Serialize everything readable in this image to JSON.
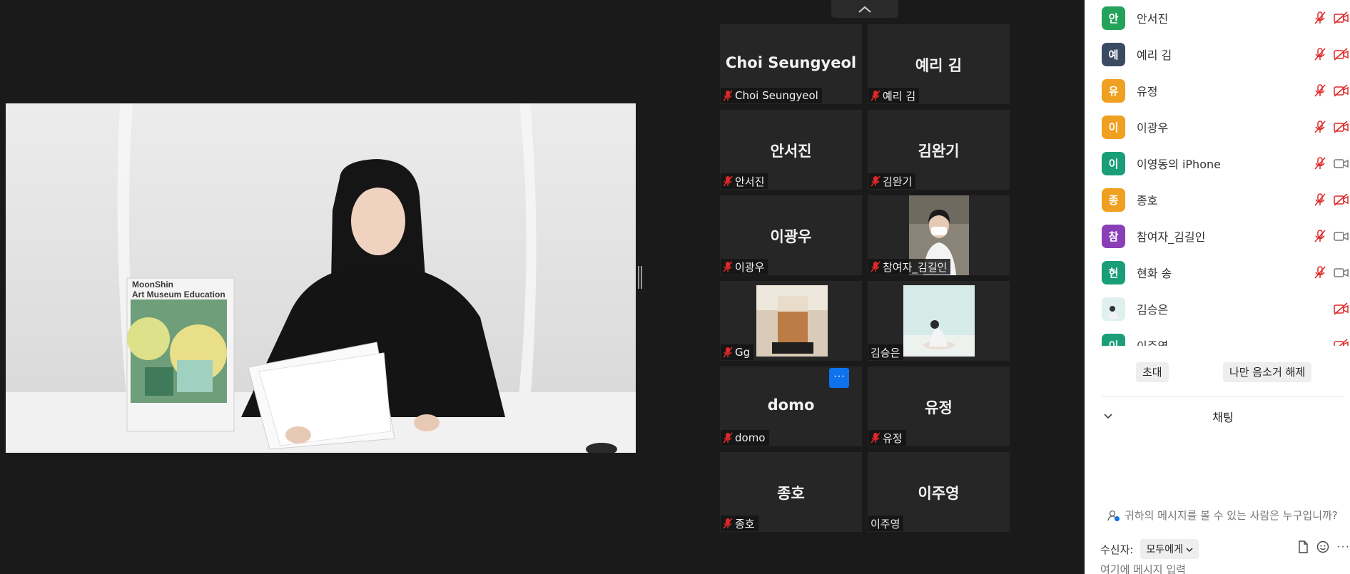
{
  "poster": {
    "title_line1": "MoonShin",
    "title_line2": "Art Museum Education"
  },
  "tiles": [
    {
      "display": "Choi Seungyeol",
      "label": "Choi Seungyeol",
      "muted": true
    },
    {
      "display": "예리 김",
      "label": "예리 김",
      "muted": true
    },
    {
      "display": "안서진",
      "label": "안서진",
      "muted": true
    },
    {
      "display": "김완기",
      "label": "김완기",
      "muted": true
    },
    {
      "display": "이광우",
      "label": "이광우",
      "muted": true
    },
    {
      "display": "",
      "label": "참여자_김길인",
      "muted": true
    },
    {
      "display": "",
      "label": "Gg",
      "muted": true
    },
    {
      "display": "",
      "label": "김승은",
      "muted": false
    },
    {
      "display": "domo",
      "label": "domo",
      "muted": true
    },
    {
      "display": "유정",
      "label": "유정",
      "muted": true
    },
    {
      "display": "종호",
      "label": "종호",
      "muted": true
    },
    {
      "display": "이주영",
      "label": "이주영",
      "muted": false
    }
  ],
  "participants": [
    {
      "initial": "안",
      "name": "안서진",
      "color": "#23a35a",
      "mic_muted": true,
      "video_off": true
    },
    {
      "initial": "예",
      "name": "예리 김",
      "color": "#3b4a63",
      "mic_muted": true,
      "video_off": true
    },
    {
      "initial": "유",
      "name": "유정",
      "color": "#f0a020",
      "mic_muted": true,
      "video_off": true
    },
    {
      "initial": "이",
      "name": "이광우",
      "color": "#f0a020",
      "mic_muted": true,
      "video_off": true
    },
    {
      "initial": "이",
      "name": "이영동의 iPhone",
      "color": "#1a9e7a",
      "mic_muted": true,
      "video_off": false
    },
    {
      "initial": "종",
      "name": "종호",
      "color": "#f0a020",
      "mic_muted": true,
      "video_off": true
    },
    {
      "initial": "참",
      "name": "참여자_김길인",
      "color": "#8a3fb8",
      "mic_muted": true,
      "video_off": false
    },
    {
      "initial": "현",
      "name": "현화 송",
      "color": "#1a9e7a",
      "mic_muted": true,
      "video_off": false
    },
    {
      "initial": "",
      "name": "김승은",
      "color": "#e9e4e4",
      "mic_muted": false,
      "video_off": true
    },
    {
      "initial": "이",
      "name": "이주영",
      "color": "#1a9e7a",
      "mic_muted": false,
      "video_off": true
    }
  ],
  "panel": {
    "invite_label": "초대",
    "unmute_self_label": "나만 음소거 해제",
    "chat_title": "채팅",
    "privacy_note": "귀하의 메시지를 볼 수 있는 사람은 누구입니까?",
    "recipient_label": "수신자:",
    "recipient_value": "모두에게",
    "input_placeholder": "여기에 메시지 입력"
  },
  "colors": {
    "accent": "#0e72ed",
    "muted_red": "#e02828",
    "background": "#1a1a1a",
    "tile": "#262626"
  }
}
